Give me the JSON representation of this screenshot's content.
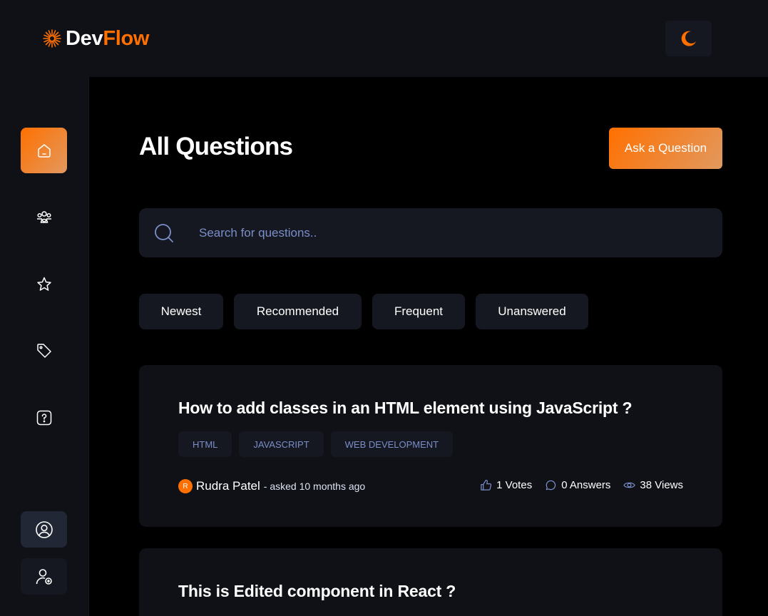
{
  "brand": {
    "part1": "Dev",
    "part2": "Flow"
  },
  "theme_toggle": {
    "icon": "moon-icon"
  },
  "sidebar": {
    "items": [
      {
        "icon": "home-icon",
        "active": true
      },
      {
        "icon": "community-icon",
        "active": false
      },
      {
        "icon": "star-icon",
        "active": false
      },
      {
        "icon": "tag-icon",
        "active": false
      },
      {
        "icon": "question-icon",
        "active": false
      }
    ],
    "bottom": [
      {
        "icon": "profile-icon"
      },
      {
        "icon": "sign-up-icon"
      }
    ]
  },
  "main": {
    "title": "All Questions",
    "ask_button": "Ask a Question",
    "search": {
      "placeholder": "Search for questions.."
    },
    "filters": [
      "Newest",
      "Recommended",
      "Frequent",
      "Unanswered"
    ],
    "questions": [
      {
        "title": "How to add classes in an HTML element using JavaScript ?",
        "tags": [
          "HTML",
          "JAVASCRIPT",
          "WEB DEVELOPMENT"
        ],
        "author_initial": "R",
        "author": "Rudra Patel",
        "asked": " - asked 10 months ago",
        "votes": "1 Votes",
        "answers": "0 Answers",
        "views": "38 Views"
      },
      {
        "title": "This is Edited component in React ?"
      }
    ]
  },
  "colors": {
    "accent": "#ff7000",
    "accent_end": "#e2995f",
    "card": "#0f1117",
    "tag_text": "#7b8ec8"
  }
}
